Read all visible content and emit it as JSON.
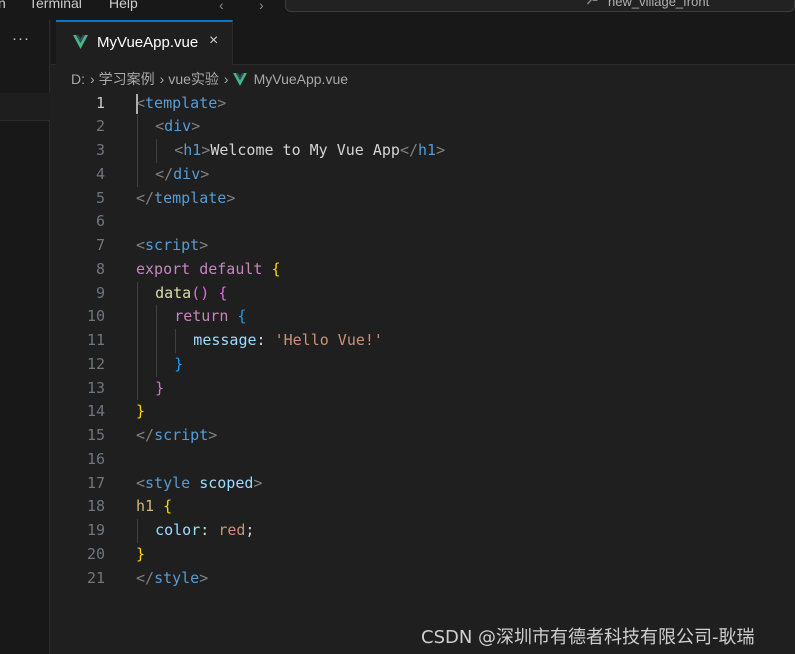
{
  "menubar": {
    "items": [
      "n",
      "Terminal",
      "Help"
    ],
    "back_arrow": "‹",
    "forward_arrow": "›",
    "search_text": "new_village_front"
  },
  "sidebar": {
    "more_label": "···"
  },
  "tab": {
    "label": "MyVueApp.vue",
    "close_label": "×",
    "icon": "vue-icon",
    "accent": "#42b883"
  },
  "breadcrumb": {
    "items": [
      "D:",
      "学习案例",
      "vue实验",
      "MyVueApp.vue"
    ],
    "separator": "›"
  },
  "editor": {
    "active_line": 1,
    "lines": [
      {
        "n": "1",
        "indent": 0,
        "tokens": [
          [
            "punct",
            "<"
          ],
          [
            "tag",
            "template"
          ],
          [
            "punct",
            ">"
          ]
        ]
      },
      {
        "n": "2",
        "indent": 1,
        "tokens": [
          [
            "punct",
            "<"
          ],
          [
            "tag",
            "div"
          ],
          [
            "punct",
            ">"
          ]
        ]
      },
      {
        "n": "3",
        "indent": 2,
        "tokens": [
          [
            "punct",
            "<"
          ],
          [
            "tag",
            "h1"
          ],
          [
            "punct",
            ">"
          ],
          [
            "text",
            "Welcome to My Vue App"
          ],
          [
            "punct",
            "</"
          ],
          [
            "tag",
            "h1"
          ],
          [
            "punct",
            ">"
          ]
        ]
      },
      {
        "n": "4",
        "indent": 1,
        "tokens": [
          [
            "punct",
            "</"
          ],
          [
            "tag",
            "div"
          ],
          [
            "punct",
            ">"
          ]
        ]
      },
      {
        "n": "5",
        "indent": 0,
        "tokens": [
          [
            "punct",
            "</"
          ],
          [
            "tag",
            "template"
          ],
          [
            "punct",
            ">"
          ]
        ]
      },
      {
        "n": "6",
        "indent": 0,
        "tokens": []
      },
      {
        "n": "7",
        "indent": 0,
        "tokens": [
          [
            "punct",
            "<"
          ],
          [
            "tag",
            "script"
          ],
          [
            "punct",
            ">"
          ]
        ]
      },
      {
        "n": "8",
        "indent": 0,
        "tokens": [
          [
            "kw",
            "export"
          ],
          [
            "text",
            " "
          ],
          [
            "kw",
            "default"
          ],
          [
            "text",
            " "
          ],
          [
            "b1",
            "{"
          ]
        ]
      },
      {
        "n": "9",
        "indent": 1,
        "tokens": [
          [
            "fn",
            "data"
          ],
          [
            "b2",
            "()"
          ],
          [
            "text",
            " "
          ],
          [
            "b2",
            "{"
          ]
        ]
      },
      {
        "n": "10",
        "indent": 2,
        "tokens": [
          [
            "kw",
            "return"
          ],
          [
            "text",
            " "
          ],
          [
            "b3",
            "{"
          ]
        ]
      },
      {
        "n": "11",
        "indent": 3,
        "tokens": [
          [
            "prop",
            "message"
          ],
          [
            "text",
            ": "
          ],
          [
            "str",
            "'Hello Vue!'"
          ]
        ]
      },
      {
        "n": "12",
        "indent": 2,
        "tokens": [
          [
            "b3",
            "}"
          ]
        ]
      },
      {
        "n": "13",
        "indent": 1,
        "tokens": [
          [
            "b2",
            "}"
          ]
        ]
      },
      {
        "n": "14",
        "indent": 0,
        "tokens": [
          [
            "b1",
            "}"
          ]
        ]
      },
      {
        "n": "15",
        "indent": 0,
        "tokens": [
          [
            "punct",
            "</"
          ],
          [
            "tag",
            "script"
          ],
          [
            "punct",
            ">"
          ]
        ]
      },
      {
        "n": "16",
        "indent": 0,
        "tokens": []
      },
      {
        "n": "17",
        "indent": 0,
        "tokens": [
          [
            "punct",
            "<"
          ],
          [
            "tag",
            "style"
          ],
          [
            "text",
            " "
          ],
          [
            "attr",
            "scoped"
          ],
          [
            "punct",
            ">"
          ]
        ]
      },
      {
        "n": "18",
        "indent": 0,
        "tokens": [
          [
            "sel",
            "h1"
          ],
          [
            "text",
            " "
          ],
          [
            "b1",
            "{"
          ]
        ]
      },
      {
        "n": "19",
        "indent": 1,
        "tokens": [
          [
            "prop",
            "color"
          ],
          [
            "text",
            ": "
          ],
          [
            "str",
            "red"
          ],
          [
            "text",
            ";"
          ]
        ]
      },
      {
        "n": "20",
        "indent": 0,
        "tokens": [
          [
            "b1",
            "}"
          ]
        ]
      },
      {
        "n": "21",
        "indent": 0,
        "tokens": [
          [
            "punct",
            "</"
          ],
          [
            "tag",
            "style"
          ],
          [
            "punct",
            ">"
          ]
        ]
      }
    ]
  },
  "watermark": "CSDN @深圳市有德者科技有限公司-耿瑞"
}
